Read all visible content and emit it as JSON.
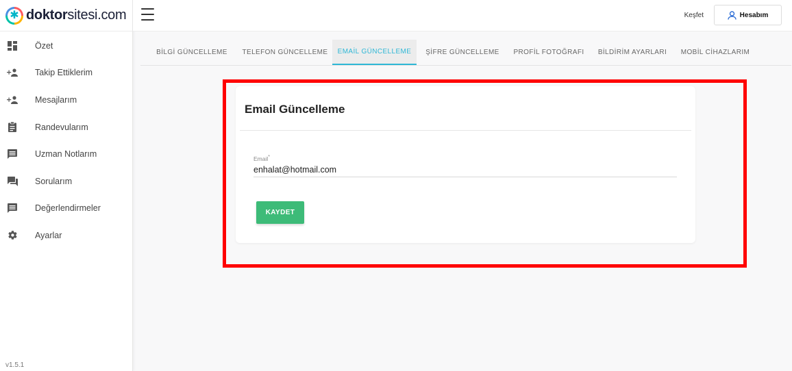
{
  "brand": {
    "bold": "doktor",
    "rest": "sitesi.com",
    "logo_icon": "asterisk-icon"
  },
  "sidebar": {
    "items": [
      {
        "label": "Özet",
        "icon": "dashboard-icon"
      },
      {
        "label": "Takip Ettiklerim",
        "icon": "person-add-icon"
      },
      {
        "label": "Mesajlarım",
        "icon": "person-add-icon"
      },
      {
        "label": "Randevularım",
        "icon": "clipboard-icon"
      },
      {
        "label": "Uzman Notlarım",
        "icon": "comment-icon"
      },
      {
        "label": "Sorularım",
        "icon": "forum-icon"
      },
      {
        "label": "Değerlendirmeler",
        "icon": "comment-icon"
      },
      {
        "label": "Ayarlar",
        "icon": "gear-icon"
      }
    ],
    "version": "v1.5.1"
  },
  "topbar": {
    "explore": "Keşfet",
    "account": "Hesabım"
  },
  "tabs": [
    {
      "label": "BİLGİ GÜNCELLEME",
      "active": false
    },
    {
      "label": "TELEFON GÜNCELLEME",
      "active": false
    },
    {
      "label": "EMAİL GÜNCELLEME",
      "active": true
    },
    {
      "label": "ŞİFRE GÜNCELLEME",
      "active": false
    },
    {
      "label": "PROFİL FOTOĞRAFI",
      "active": false
    },
    {
      "label": "BİLDİRİM AYARLARI",
      "active": false
    },
    {
      "label": "MOBİL CİHAZLARIM",
      "active": false
    }
  ],
  "card": {
    "title": "Email Güncelleme",
    "field_label": "Email",
    "required_mark": "*",
    "email_value": "enhalat@hotmail.com",
    "save_label": "KAYDET"
  },
  "colors": {
    "accent": "#2eb7d6",
    "save": "#3dbb78",
    "highlight": "#ff0000"
  }
}
